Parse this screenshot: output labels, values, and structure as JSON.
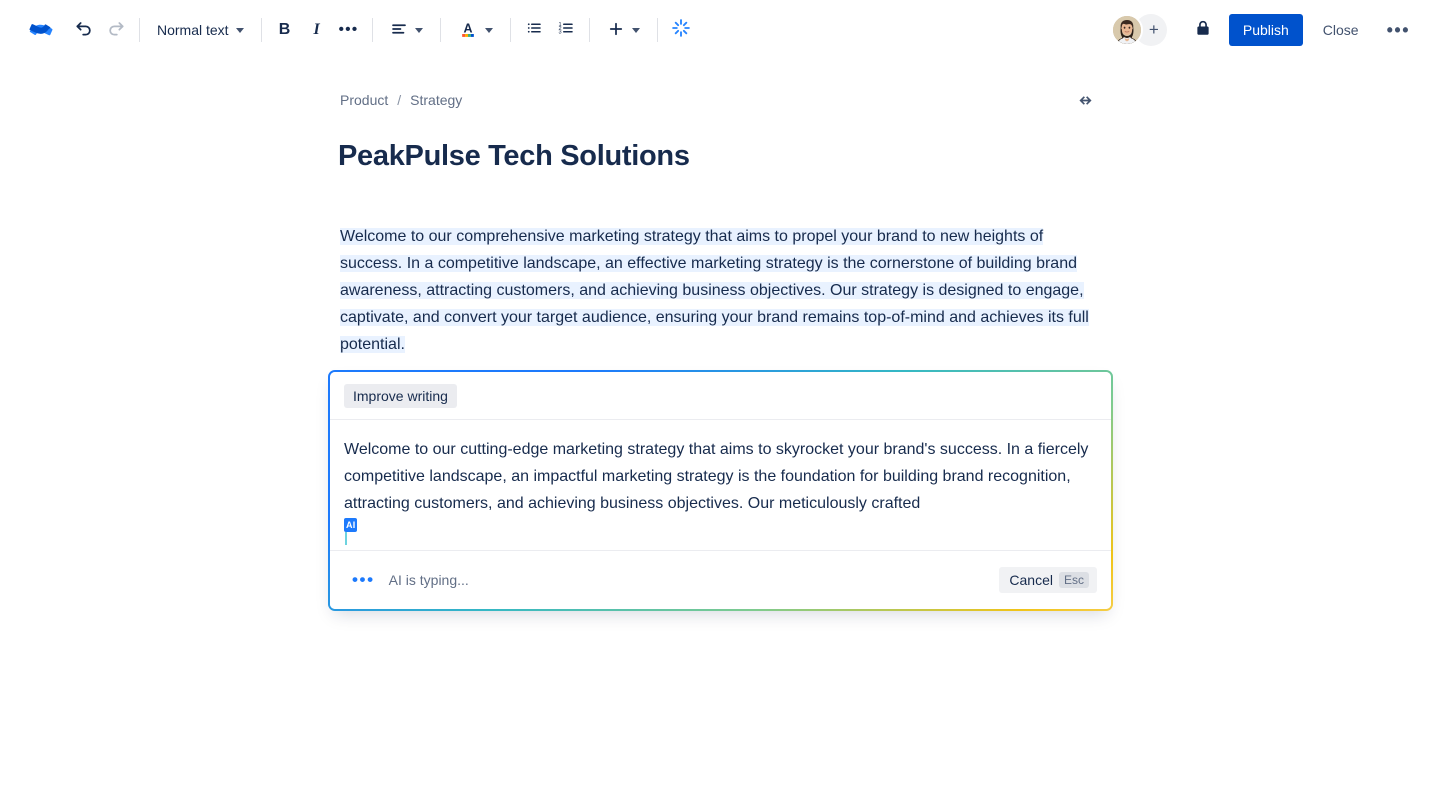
{
  "toolbar": {
    "logo_icon": "confluence-logo-icon",
    "undo_icon": "undo-arrow-icon",
    "redo_icon": "redo-arrow-icon",
    "text_style_label": "Normal text",
    "bold_label": "B",
    "italic_label": "I",
    "more_formatting_label": "•••",
    "align_icon": "text-align-icon",
    "text_color_icon": "text-color-A-icon",
    "bullet_list_icon": "bullet-list-icon",
    "numbered_list_icon": "numbered-list-icon",
    "insert_icon": "plus-insert-icon",
    "ai_icon": "ai-sparkle-icon",
    "avatar_name": "user-avatar",
    "add_person_label": "+",
    "lock_icon": "lock-icon",
    "publish_label": "Publish",
    "close_label": "Close",
    "more_actions_label": "•••"
  },
  "breadcrumb": {
    "items": [
      "Product",
      "Strategy"
    ],
    "separator": "/"
  },
  "page": {
    "width_toggle_icon": "expand-width-icon",
    "title": "PeakPulse Tech Solutions",
    "paragraph": "Welcome to our comprehensive marketing strategy that aims to propel your brand to new heights of success. In a competitive landscape, an effective marketing strategy is the cornerstone of building brand awareness, attracting customers, and achieving business objectives. Our strategy is designed to engage, captivate, and convert your target audience, ensuring your brand remains top-of-mind and achieves its full potential."
  },
  "ai_panel": {
    "prompt_chip": "Improve writing",
    "generated_text": "Welcome to our cutting-edge marketing strategy that aims to skyrocket your brand's success. In a fiercely competitive landscape, an impactful marketing strategy is the foundation for building brand recognition, attracting customers, and achieving business objectives. Our meticulously crafted",
    "cursor_badge": "AI",
    "typing_dots": "•••",
    "status_text": "AI is typing...",
    "cancel_label": "Cancel",
    "cancel_shortcut": "Esc"
  },
  "colors": {
    "brand_blue": "#0052cc",
    "ai_blue": "#1d7afc",
    "selection_blue": "#e9f2ff",
    "text_primary": "#172b4d",
    "text_subtle": "#626f86",
    "gradient_start": "#1d7afc",
    "gradient_mid": "#35b8c4",
    "gradient_end": "#f5cd47"
  }
}
